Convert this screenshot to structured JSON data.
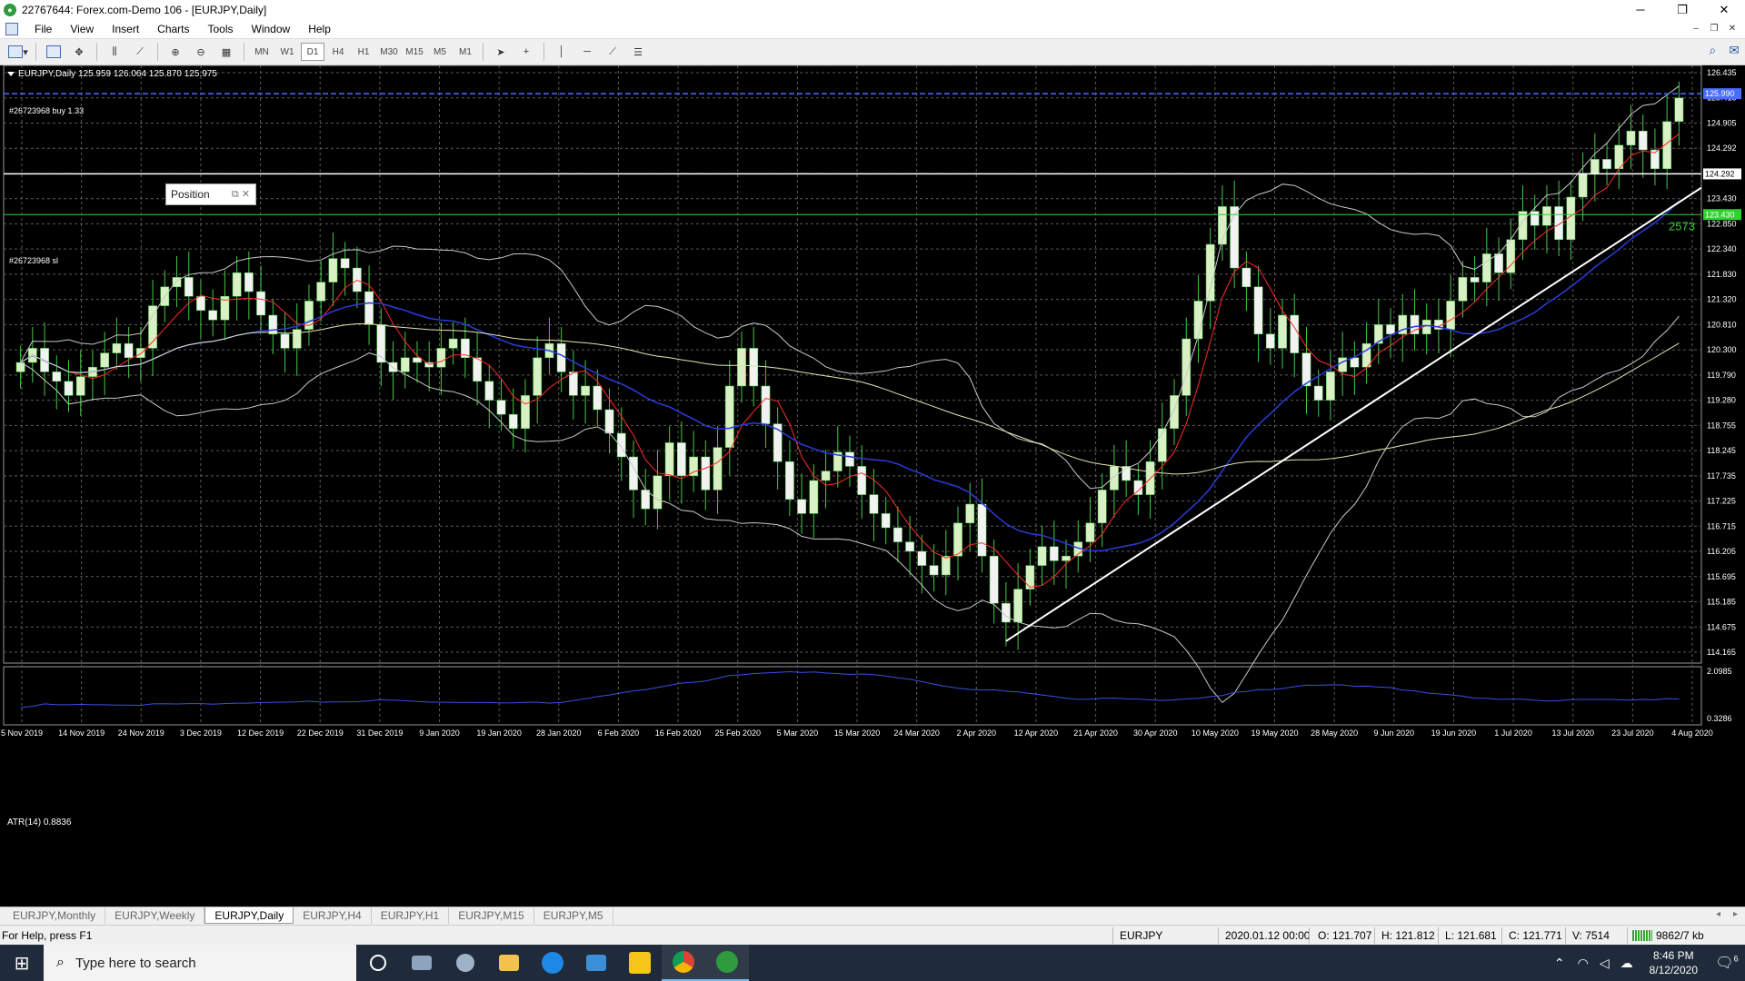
{
  "window": {
    "title": "22767644: Forex.com-Demo 106 - [EURJPY,Daily]",
    "minimize": "─",
    "maximize": "❐",
    "close": "✕"
  },
  "menu": {
    "items": [
      "File",
      "View",
      "Insert",
      "Charts",
      "Tools",
      "Window",
      "Help"
    ],
    "mdi_controls": [
      "–",
      "❐",
      "✕"
    ]
  },
  "toolbar": {
    "timeframes": [
      "MN",
      "W1",
      "D1",
      "H4",
      "H1",
      "M30",
      "M15",
      "M5",
      "M1"
    ],
    "active_timeframe": "D1"
  },
  "chart": {
    "header": "EURJPY,Daily  125.959 126.064 125.870 125.975",
    "order_buy_label": "#26723968 buy 1.33",
    "order_sl_label": "#26723968 sl",
    "position_panel_label": "Position",
    "position_panel_icons": "⧉  ✕",
    "atr_label": "ATR(14) 0.8836",
    "trendline_label": "2573",
    "colors": {
      "background": "#000000",
      "grid": "#5a5a5a",
      "bull_candle": "#d8f0c4",
      "bear_candle": "#f2f2f2",
      "wick": "#45c845",
      "bollinger": "#c8c8c8",
      "ma_red": "#ff2a2a",
      "ma_blue": "#2b3bd9",
      "ma_yellow": "#e6e6b0",
      "buy_line": "#4a6cff",
      "sl_line": "#2fd12f",
      "atr_line": "#3b4fe0",
      "trendline": "#ffffff"
    }
  },
  "chart_data": {
    "type": "candlestick",
    "title": "EURJPY,Daily",
    "y_axis_ticks": [
      "126.435",
      "125.415",
      "124.905",
      "124.292",
      "123.885",
      "123.430",
      "122.850",
      "122.340",
      "121.830",
      "121.320",
      "120.810",
      "120.300",
      "119.790",
      "119.280",
      "118.755",
      "118.245",
      "117.735",
      "117.225",
      "116.715",
      "116.205",
      "115.695",
      "115.185",
      "114.675",
      "114.165"
    ],
    "ylim": [
      114.165,
      126.435
    ],
    "x_axis_ticks": [
      "5 Nov 2019",
      "14 Nov 2019",
      "24 Nov 2019",
      "3 Dec 2019",
      "12 Dec 2019",
      "22 Dec 2019",
      "31 Dec 2019",
      "9 Jan 2020",
      "19 Jan 2020",
      "28 Jan 2020",
      "6 Feb 2020",
      "16 Feb 2020",
      "25 Feb 2020",
      "5 Mar 2020",
      "15 Mar 2020",
      "24 Mar 2020",
      "2 Apr 2020",
      "12 Apr 2020",
      "21 Apr 2020",
      "30 Apr 2020",
      "10 May 2020",
      "19 May 2020",
      "28 May 2020",
      "9 Jun 2020",
      "19 Jun 2020",
      "1 Jul 2020",
      "13 Jul 2020",
      "23 Jul 2020",
      "4 Aug 2020"
    ],
    "close_series": [
      120.3,
      120.6,
      120.1,
      119.9,
      119.6,
      120.0,
      120.2,
      120.5,
      120.7,
      120.4,
      120.6,
      121.5,
      121.9,
      122.1,
      121.7,
      121.4,
      121.2,
      121.7,
      122.2,
      121.8,
      121.3,
      120.9,
      120.6,
      121.0,
      121.6,
      122.0,
      122.5,
      122.3,
      121.8,
      121.1,
      120.3,
      120.1,
      120.4,
      120.3,
      120.2,
      120.6,
      120.8,
      120.4,
      119.9,
      119.5,
      119.2,
      118.9,
      119.6,
      120.4,
      120.7,
      120.1,
      119.6,
      119.8,
      119.3,
      118.8,
      118.3,
      117.6,
      117.2,
      117.9,
      118.6,
      117.9,
      118.3,
      117.6,
      118.5,
      119.8,
      120.6,
      119.8,
      119.0,
      118.2,
      117.4,
      117.1,
      117.8,
      118.0,
      118.4,
      118.1,
      117.5,
      117.1,
      116.8,
      116.5,
      116.3,
      116.0,
      115.8,
      116.2,
      116.9,
      117.3,
      116.2,
      115.2,
      114.8,
      115.5,
      116.0,
      116.4,
      116.1,
      116.2,
      116.5,
      116.9,
      117.6,
      118.1,
      117.8,
      117.5,
      118.2,
      118.9,
      119.6,
      120.8,
      121.6,
      122.8,
      123.6,
      122.3,
      121.9,
      120.9,
      120.6,
      121.3,
      120.5,
      119.8,
      119.5,
      120.1,
      120.4,
      120.2,
      120.7,
      121.1,
      120.9,
      121.3,
      120.9,
      121.2,
      121.0,
      121.6,
      122.1,
      122.0,
      122.6,
      122.2,
      122.9,
      123.5,
      123.2,
      123.6,
      122.9,
      123.8,
      124.3,
      124.6,
      124.4,
      124.9,
      125.2,
      124.8,
      124.4,
      125.4,
      125.9
    ],
    "series": [
      {
        "name": "ATR(14)",
        "last_value": 0.8836,
        "ylim": [
          0.3286,
          2.0985
        ],
        "ticks": [
          "2.0985",
          "0.3286"
        ]
      }
    ],
    "horizontal_lines": [
      {
        "label": "#26723968 buy 1.33",
        "price_tag": "125.990"
      },
      {
        "label": "",
        "price_tag": "124.292"
      },
      {
        "label": "#26723968 sl",
        "price_tag": "123.430"
      }
    ]
  },
  "tabs": [
    "EURJPY,Monthly",
    "EURJPY,Weekly",
    "EURJPY,Daily",
    "EURJPY,H4",
    "EURJPY,H1",
    "EURJPY,M15",
    "EURJPY,M5"
  ],
  "active_tab": "EURJPY,Daily",
  "statusbar": {
    "help": "For Help, press F1",
    "symbol": "EURJPY",
    "datetime": "2020.01.12 00:00",
    "open": "O: 121.707",
    "high": "H: 121.812",
    "low": "L: 121.681",
    "close": "C: 121.771",
    "volume": "V: 7514",
    "traffic": "9862/7 kb"
  },
  "taskbar": {
    "search_placeholder": "Type here to search",
    "time": "8:46 PM",
    "date": "8/12/2020",
    "notification_count": "6"
  }
}
